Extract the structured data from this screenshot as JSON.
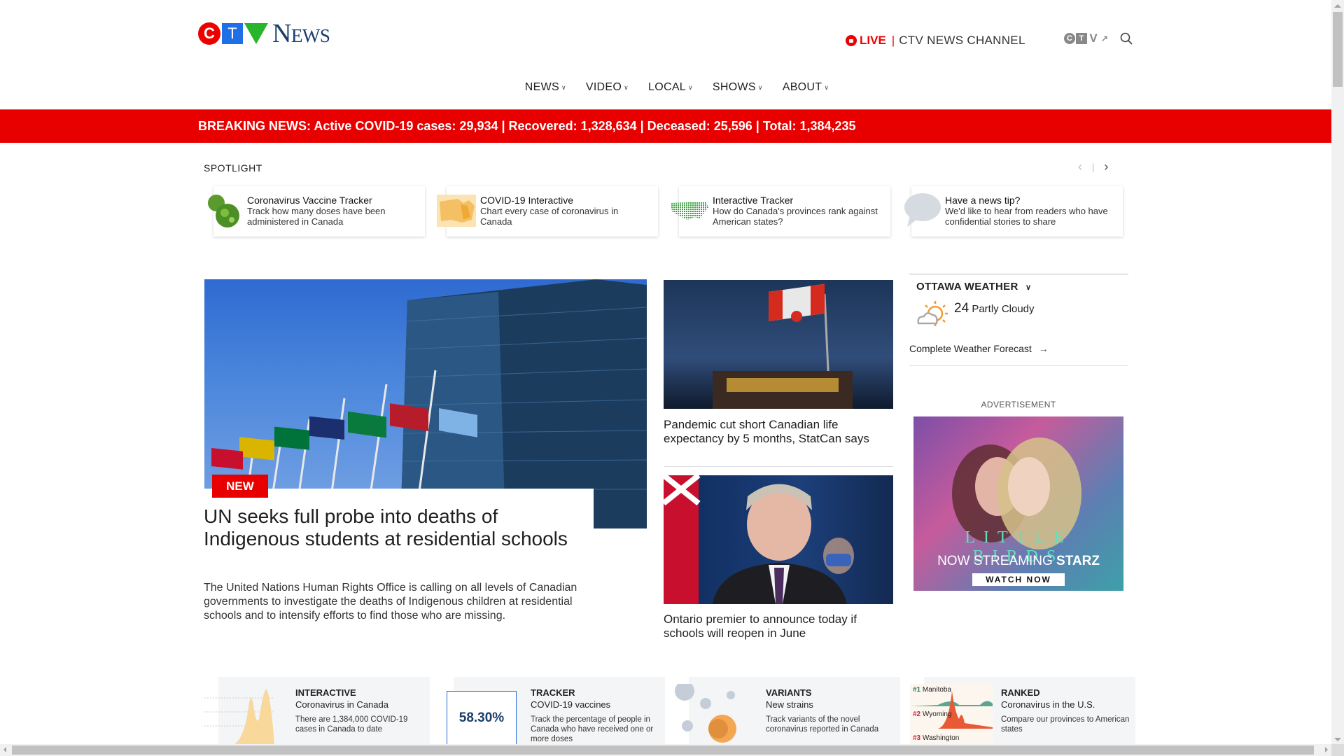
{
  "brand": {
    "c": "C",
    "t": "T",
    "v": "V",
    "news": "News"
  },
  "header": {
    "live_label": "LIVE",
    "separator": "|",
    "channel": "CTV NEWS CHANNEL",
    "ctv_link": {
      "c": "C",
      "t": "T",
      "v": "V",
      "ext": "↗"
    }
  },
  "nav": [
    {
      "label": "NEWS"
    },
    {
      "label": "VIDEO"
    },
    {
      "label": "LOCAL"
    },
    {
      "label": "SHOWS"
    },
    {
      "label": "ABOUT"
    }
  ],
  "breaking": "BREAKING NEWS: Active COVID-19 cases: 29,934 | Recovered: 1,328,634 | Deceased: 25,596 | Total: 1,384,235",
  "spotlight": {
    "label": "SPOTLIGHT",
    "prev": "‹",
    "divider": "|",
    "next": "›",
    "cards": [
      {
        "title": "Coronavirus Vaccine Tracker",
        "desc": "Track how many doses have been administered in Canada"
      },
      {
        "title": "COVID-19 Interactive",
        "desc": "Chart every case of coronavirus in Canada"
      },
      {
        "title": "Interactive Tracker",
        "desc": "How do Canada's provinces rank against American states?"
      },
      {
        "title": "Have a news tip?",
        "desc": "We'd like to hear from readers who have confidential stories to share"
      }
    ]
  },
  "hero": {
    "badge": "NEW",
    "title": "UN seeks full probe into deaths of Indigenous students at residential schools",
    "summary": "The United Nations Human Rights Office is calling on all levels of Canadian governments to investigate the deaths of Indigenous children at residential schools and to intensify efforts to find those who are missing."
  },
  "side_stories": [
    {
      "title": "Pandemic cut short Canadian life expectancy by 5 months, StatCan says"
    },
    {
      "title": "Ontario premier to announce today if schools will reopen in June"
    }
  ],
  "weather": {
    "title": "OTTAWA WEATHER",
    "temp": "24",
    "condition": "Partly Cloudy",
    "forecast_link": "Complete Weather Forecast",
    "arrow": "→"
  },
  "ad": {
    "label": "ADVERTISEMENT",
    "show": "LITTLE BIRDS",
    "tagline": "NOW STREAMING",
    "network": "STARZ",
    "cta": "WATCH NOW"
  },
  "bottom_cards": [
    {
      "kicker": "INTERACTIVE",
      "headline": "Coronavirus in Canada",
      "desc": "There are 1,384,000 COVID-19 cases in Canada to date"
    },
    {
      "kicker": "TRACKER",
      "headline": "COVID-19 vaccines",
      "desc": "Track the percentage of people in Canada who have received one or more doses",
      "stat": "58.30%"
    },
    {
      "kicker": "VARIANTS",
      "headline": "New strains",
      "desc": "Track variants of the novel coronavirus reported in Canada"
    },
    {
      "kicker": "RANKED",
      "headline": "Coronavirus in the U.S.",
      "desc": "Compare our provinces to American states",
      "ranks": [
        {
          "rank": "#1",
          "name": "Manitoba"
        },
        {
          "rank": "#2",
          "name": "Wyoming"
        },
        {
          "rank": "#3",
          "name": "Washington"
        }
      ]
    }
  ],
  "colors": {
    "brand_red": "#e80000",
    "ctv_blue": "#1f6fe6",
    "ctv_green": "#27b52b",
    "news_navy": "#1a3e6b",
    "weather_sun": "#f39b2a"
  }
}
